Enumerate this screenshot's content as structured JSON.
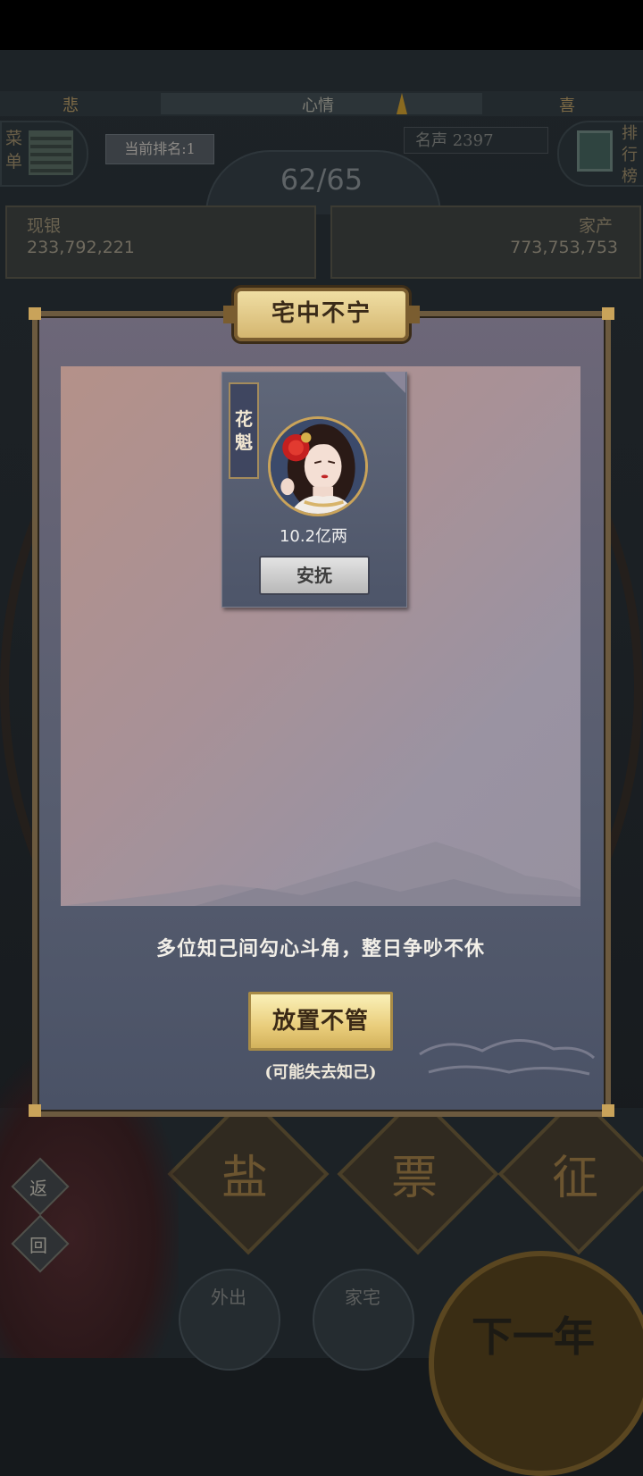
{
  "hud": {
    "mood_sad": "悲",
    "mood_label": "心情",
    "mood_happy": "喜",
    "mood_level": 0.75,
    "menu_label": "菜单",
    "current_rank": "当前排名:1",
    "fame": "名声 2397",
    "ranking_label": "排行榜",
    "turn_current": "62",
    "turn_total": "65",
    "turn_display": "62/65",
    "silver_label": "现银",
    "silver_value": "233,792,221",
    "assets_label": "家产",
    "assets_value": "773,753,753"
  },
  "bottom": {
    "tile_1": "盐",
    "tile_2": "票",
    "tile_3": "征",
    "back_label": "返",
    "return_label": "回",
    "go_out_label": "外出",
    "home_label": "家宅",
    "next_year_label": "下一年"
  },
  "modal": {
    "title": "宅中不宁",
    "card": {
      "tag": "花魁",
      "price": "10.2亿两",
      "action": "安抚"
    },
    "description": "多位知己间勾心斗角，整日争吵不休",
    "ignore_button": "放置不管",
    "ignore_note": "(可能失去知己)"
  },
  "colors": {
    "modal_bg": "#575d6f",
    "gold_button": "#e9cd7b",
    "title_plate": "#e2c984",
    "card_bg": "#565e72"
  }
}
